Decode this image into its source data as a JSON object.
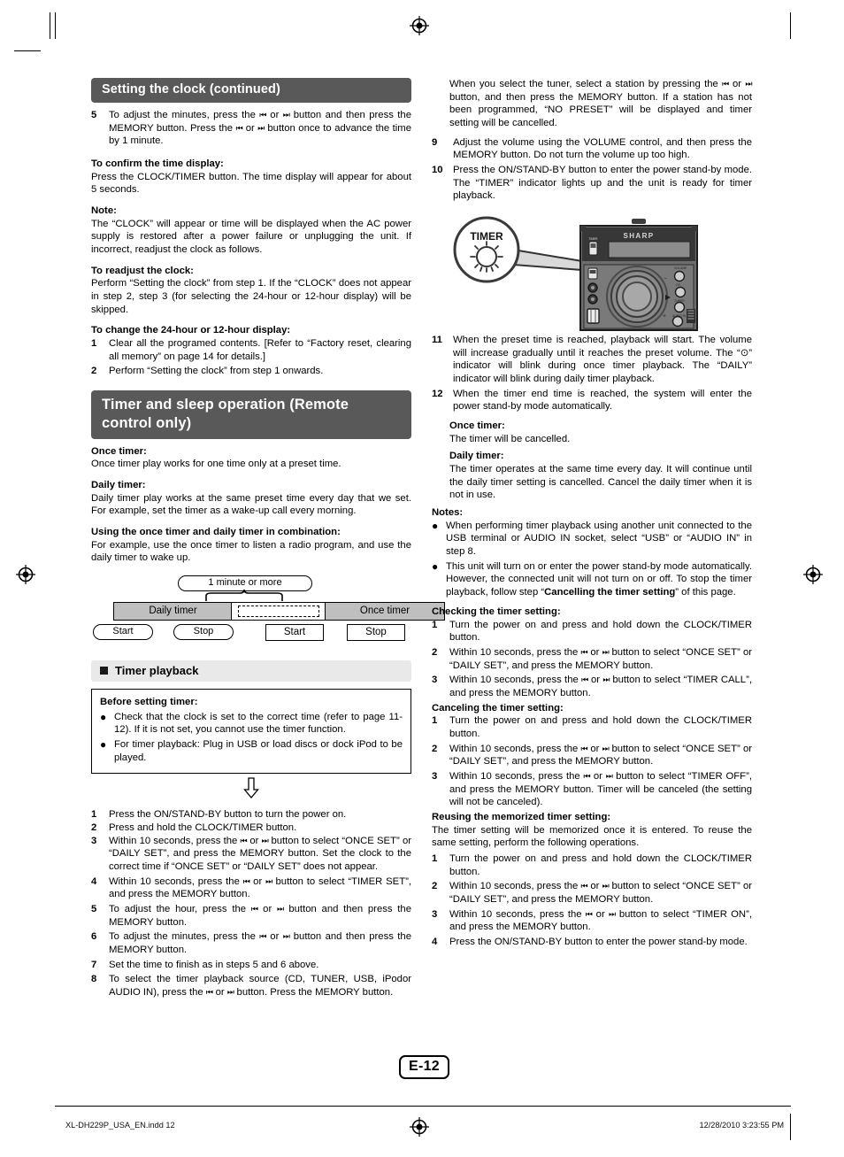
{
  "page": {
    "number_label": "E-12",
    "footer_file": "XL-DH229P_USA_EN.indd   12",
    "footer_datetime": "12/28/2010   3:23:55 PM"
  },
  "left_column": {
    "section_title": "Setting the clock (continued)",
    "step5": {
      "num": "5",
      "text_a": "To adjust the minutes, press the ",
      "text_b": " or ",
      "text_c": " button and then press the MEMORY button. Press the ",
      "text_d": " or ",
      "text_e": " button once to advance the time by 1 minute."
    },
    "confirm_heading": "To confirm the time display:",
    "confirm_body": "Press the CLOCK/TIMER button. The time display will appear for about 5 seconds.",
    "note_heading": "Note:",
    "note_body": "The “CLOCK” will appear or time will be displayed when the AC power supply is restored after a power failure or unplugging the unit. If incorrect, readjust the clock as follows.",
    "readjust_heading": "To readjust the clock:",
    "readjust_body": "Perform “Setting the clock” from step 1. If the “CLOCK” does not appear in step 2, step 3 (for selecting the 24-hour or 12-hour display) will be skipped.",
    "change_heading": "To change the 24-hour or 12-hour display:",
    "change_steps": [
      {
        "num": "1",
        "text": "Clear all the programed contents. [Refer to “Factory reset, clearing all memory” on page 14 for details.]"
      },
      {
        "num": "2",
        "text": "Perform “Setting the clock” from step 1 onwards."
      }
    ],
    "timer_section_title": "Timer and sleep operation (Remote control only)",
    "once_timer_heading": "Once timer:",
    "once_timer_body": "Once timer play works for one time only at a preset time.",
    "daily_timer_heading": "Daily timer:",
    "daily_timer_body": "Daily timer play works at the same preset time every day that we set. For example, set the timer as a wake-up call every morning.",
    "combination_heading": "Using the once timer and daily timer in combination:",
    "combination_body": "For example, use the once timer to listen a radio program, and use the daily timer to wake up.",
    "diagram": {
      "gap_label": "1 minute or more",
      "daily_timer": "Daily timer",
      "once_timer": "Once timer",
      "daily_start": "Start",
      "daily_stop": "Stop",
      "once_start": "Start",
      "once_stop": "Stop"
    },
    "timer_playback_bar": "Timer playback",
    "before_box": {
      "heading": "Before setting timer:",
      "bullets": [
        "Check that the clock is set to the correct time (refer to page 11-12). If it is not set, you cannot use the timer function.",
        "For timer playback: Plug in USB or load discs or dock iPod to be played."
      ]
    },
    "steps": [
      {
        "num": "1",
        "text": "Press the ON/STAND-BY button to turn the power on."
      },
      {
        "num": "2",
        "text": "Press and hold the CLOCK/TIMER button."
      },
      {
        "num": "3",
        "pre": "Within 10 seconds, press the ",
        "mid": " or ",
        "post": " button to select “ONCE SET” or “DAILY SET”, and press the MEMORY button. Set the clock to the correct time if “ONCE SET” or “DAILY SET” does not appear."
      },
      {
        "num": "4",
        "pre": "Within 10 seconds, press the ",
        "mid": " or ",
        "post": " button to select “TIMER SET”, and press the MEMORY button."
      },
      {
        "num": "5",
        "pre": "To adjust the hour, press the ",
        "mid": " or ",
        "post": " button and then press the MEMORY button."
      },
      {
        "num": "6",
        "pre": "To adjust the minutes, press the ",
        "mid": " or ",
        "post": " button and then press the MEMORY button."
      },
      {
        "num": "7",
        "text": "Set the time to finish as in steps 5 and 6 above."
      },
      {
        "num": "8",
        "pre": "To select the timer playback source (CD, TUNER, USB, iPodor AUDIO IN), press the ",
        "mid": " or ",
        "post": " button. Press the MEMORY button."
      }
    ]
  },
  "right_column": {
    "tuner_note": {
      "pre": "When you select the tuner, select a station by pressing the ",
      "mid": " or ",
      "post": " button, and then press the MEMORY button. If a station has not been programmed, “NO PRESET” will be displayed and timer setting will be cancelled."
    },
    "step9": {
      "num": "9",
      "text": "Adjust the volume using the VOLUME control, and then press the MEMORY button. Do not turn the volume up too high."
    },
    "step10": {
      "num": "10",
      "text": "Press the ON/STAND-BY button to enter the power stand-by mode. The “TIMER” indicator lights up and the unit is ready for timer playback."
    },
    "illustration": {
      "callout_label": "TIMER",
      "brand_label": "SHARP"
    },
    "step11": {
      "num": "11",
      "text": "When the preset time is reached, playback will start. The volume will increase gradually until it reaches the preset volume. The “⊙” indicator will blink during once timer playback. The “DAILY” indicator will blink during daily timer playback."
    },
    "step12": {
      "num": "12",
      "text": "When the timer end time is reached, the system will enter the power stand-by mode automatically."
    },
    "once_timer_heading": "Once timer:",
    "once_timer_body": "The timer will be cancelled.",
    "daily_timer_heading": "Daily timer:",
    "daily_timer_body": "The timer operates at the same time every day. It will continue until the daily timer setting is cancelled. Cancel the daily timer when it is not in use.",
    "notes_heading": "Notes:",
    "notes": [
      {
        "text": "When performing timer playback using another unit connected to the USB terminal or AUDIO IN socket, select “USB” or “AUDIO IN” in step 8."
      },
      {
        "pre": "This unit will turn on or enter the power stand-by mode automatically. However, the connected unit will not turn on or off. To stop the timer playback, follow step “",
        "bold": "Cancelling the timer setting",
        "post": "” of this page."
      }
    ],
    "checking_heading": "Checking the timer setting:",
    "checking_steps": [
      {
        "num": "1",
        "text": "Turn the power on and press and hold down the CLOCK/TIMER button."
      },
      {
        "num": "2",
        "pre": "Within 10 seconds, press the ",
        "mid": " or ",
        "post": " button to select “ONCE SET” or “DAILY SET”, and press the MEMORY button."
      },
      {
        "num": "3",
        "pre": "Within 10 seconds, press the ",
        "mid": " or ",
        "post": " button to select “TIMER CALL”, and press the MEMORY button."
      }
    ],
    "canceling_heading": "Canceling the timer setting:",
    "canceling_steps": [
      {
        "num": "1",
        "text": "Turn the power on and press and hold down the CLOCK/TIMER button."
      },
      {
        "num": "2",
        "pre": "Within 10 seconds, press the ",
        "mid": " or ",
        "post": " button to select “ONCE SET” or “DAILY SET”, and press the MEMORY button."
      },
      {
        "num": "3",
        "pre": "Within 10 seconds, press the ",
        "mid": " or ",
        "post": " button to select “TIMER OFF”, and press the MEMORY button. Timer will be canceled (the setting will not be canceled)."
      }
    ],
    "reusing_heading": "Reusing the memorized timer setting:",
    "reusing_body": "The timer setting will be memorized once it is entered. To reuse the same setting, perform the following operations.",
    "reusing_steps": [
      {
        "num": "1",
        "text": "Turn the power on and press and hold down the CLOCK/TIMER button."
      },
      {
        "num": "2",
        "pre": "Within 10 seconds, press the ",
        "mid": " or ",
        "post": " button to select “ONCE SET” or “DAILY SET”, and press the MEMORY button."
      },
      {
        "num": "3",
        "pre": "Within 10 seconds, press the ",
        "mid": " or ",
        "post": " button to select “TIMER ON”, and press the MEMORY button."
      },
      {
        "num": "4",
        "text": "Press the ON/STAND-BY button to enter the power stand-by mode."
      }
    ]
  },
  "glyphs": {
    "prev": "⏮",
    "next": "⏭"
  },
  "colors": {
    "section_bar": "#595959",
    "sub_bar": "#e9e9e9",
    "diagram_fill": "#bfbfbf"
  }
}
